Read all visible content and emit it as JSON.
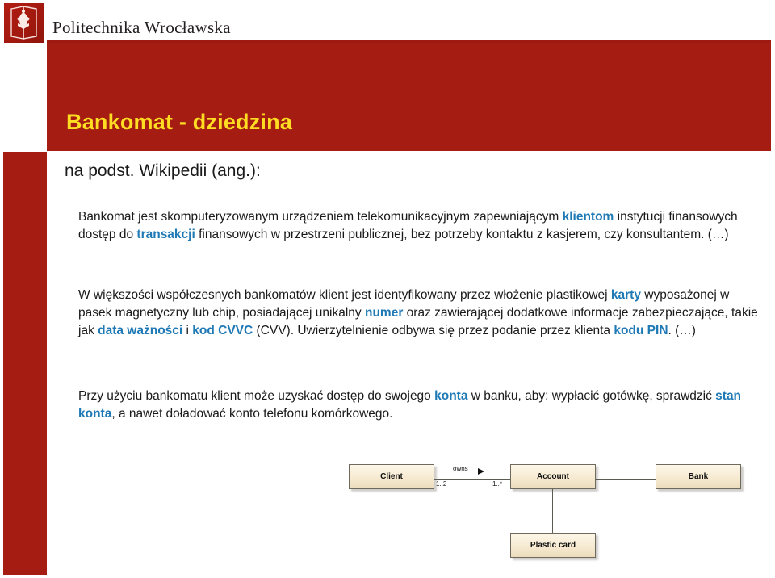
{
  "header": {
    "university": "Politechnika Wrocławska",
    "logo_icon": "politechnika-wroclawska-eagle-logo"
  },
  "title": "Bankomat - dziedzina",
  "subtitle": "na podst. Wikipedii (ang.):",
  "colors": {
    "brand_red": "#a51c12",
    "title_yellow": "#ffdd22",
    "highlight_blue": "#1f79b5",
    "box_fill": "#f6ead1",
    "box_border": "#6f6a5e"
  },
  "paragraphs": [
    {
      "id": "para-1",
      "runs": [
        {
          "t": "Bankomat jest skomputeryzowanym urządzeniem telekomunikacyjnym zapewniającym ",
          "hl": false
        },
        {
          "t": "klientom",
          "hl": true
        },
        {
          "t": " instytucji finansowych dostęp do ",
          "hl": false
        },
        {
          "t": "transakcji",
          "hl": true
        },
        {
          "t": " finansowych w przestrzeni publicznej, bez potrzeby kontaktu  z kasjerem, czy konsultantem. (…)",
          "hl": false
        }
      ]
    },
    {
      "id": "para-2",
      "runs": [
        {
          "t": "W większości współczesnych bankomatów klient jest identyfikowany przez włożenie plastikowej ",
          "hl": false
        },
        {
          "t": "karty",
          "hl": true
        },
        {
          "t": " wyposażonej w pasek magnetyczny lub chip, posiadającej unikalny ",
          "hl": false
        },
        {
          "t": "numer",
          "hl": true
        },
        {
          "t": " oraz zawierającej dodatkowe informacje zabezpieczające, takie jak ",
          "hl": false
        },
        {
          "t": "data ważności",
          "hl": true
        },
        {
          "t": " i ",
          "hl": false
        },
        {
          "t": "kod CVVC",
          "hl": true
        },
        {
          "t": " (CVV). Uwierzytelnienie odbywa się przez podanie przez klienta ",
          "hl": false
        },
        {
          "t": "kodu PIN",
          "hl": true
        },
        {
          "t": ". (…)",
          "hl": false
        }
      ]
    },
    {
      "id": "para-3",
      "runs": [
        {
          "t": "Przy użyciu bankomatu klient może uzyskać dostęp do swojego ",
          "hl": false
        },
        {
          "t": "konta",
          "hl": true
        },
        {
          "t": " w banku, aby: wypłacić gotówkę, sprawdzić ",
          "hl": false
        },
        {
          "t": "stan konta",
          "hl": true
        },
        {
          "t": ", a nawet doładować konto telefonu komórkowego.",
          "hl": false
        }
      ]
    }
  ],
  "diagram": {
    "boxes": {
      "client": "Client",
      "account": "Account",
      "bank": "Bank",
      "plastic_card": "Plastic card"
    },
    "association_label": "owns",
    "multiplicity_client": "1..2",
    "multiplicity_account": "1..*"
  }
}
